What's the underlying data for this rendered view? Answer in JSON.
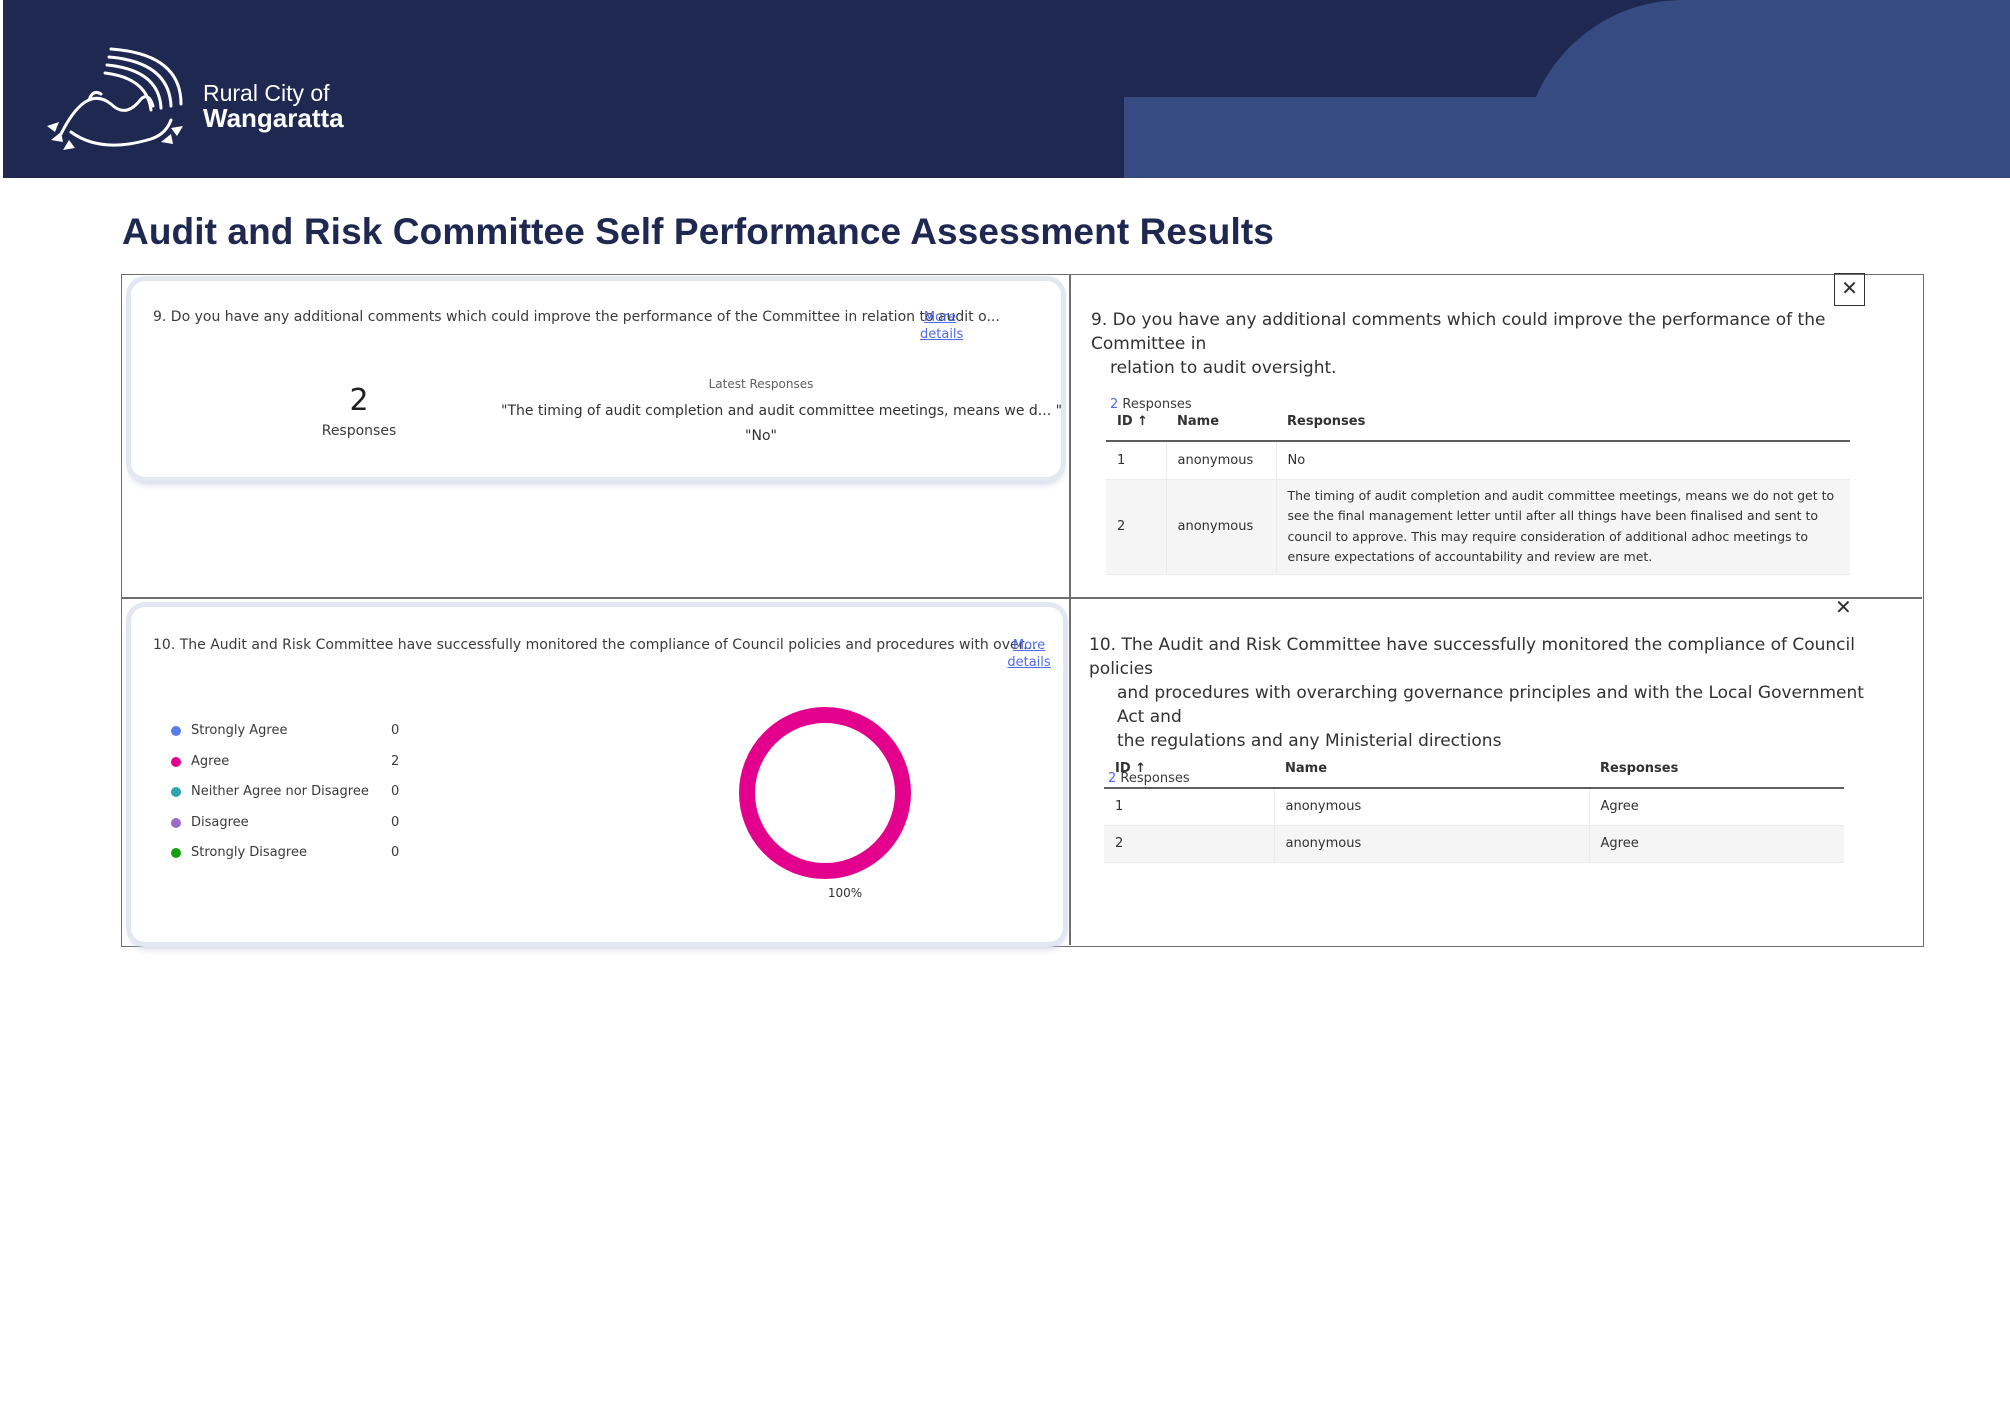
{
  "header": {
    "org_line1": "Rural City of",
    "org_line2": "Wangaratta"
  },
  "page_title": "Audit and Risk Committee Self Performance Assessment Results",
  "q9_card": {
    "question": "9. Do you have any additional comments which could improve the performance of the Committee in relation to audit o...",
    "more_details_1": "More",
    "more_details_2": "details",
    "response_count": "2",
    "response_count_label": "Responses",
    "latest_heading": "Latest Responses",
    "latest_responses": [
      "\"The timing of audit completion and audit committee meetings, means we d... \"",
      "\"No\""
    ]
  },
  "q9_detail": {
    "title": "9. Do you have any additional comments which could improve the performance of the Committee in relation to audit oversight.",
    "title_line1": "9. Do you have any additional comments which could improve the performance of the Committee in",
    "title_line2": "relation to audit oversight.",
    "response_count": "2",
    "response_label": "Responses",
    "columns": [
      "ID ↑",
      "Name",
      "Responses"
    ],
    "rows": [
      {
        "id": "1",
        "name": "anonymous",
        "response": "No"
      },
      {
        "id": "2",
        "name": "anonymous",
        "response": "The timing of audit completion and audit committee meetings, means we do not get to see the final management letter until after all things have been finalised and sent to council to approve. This may require consideration of additional adhoc meetings to ensure expectations of accountability and review are met."
      }
    ]
  },
  "q10_card": {
    "question": "10. The Audit and Risk Committee have successfully monitored the compliance of Council policies and procedures with over...",
    "more_details_1": "More",
    "more_details_2": "details",
    "legend": [
      {
        "label": "Strongly Agree",
        "value": "0",
        "color": "#5b7be8"
      },
      {
        "label": "Agree",
        "value": "2",
        "color": "#e3008c"
      },
      {
        "label": "Neither Agree nor Disagree",
        "value": "0",
        "color": "#2ba5b0"
      },
      {
        "label": "Disagree",
        "value": "0",
        "color": "#9b6bc7"
      },
      {
        "label": "Strongly Disagree",
        "value": "0",
        "color": "#13a10e"
      }
    ],
    "donut_label": "100%"
  },
  "q10_detail": {
    "title_line1": "10. The Audit and Risk Committee have successfully monitored the compliance of Council policies",
    "title_line2": "and procedures with overarching governance principles and with the Local Government Act and",
    "title_line3": "the regulations and any Ministerial directions",
    "response_count": "2",
    "response_label": "Responses",
    "columns": [
      "ID ↑",
      "Name",
      "Responses"
    ],
    "rows": [
      {
        "id": "1",
        "name": "anonymous",
        "response": "Agree"
      },
      {
        "id": "2",
        "name": "anonymous",
        "response": "Agree"
      }
    ]
  },
  "chart_data": {
    "type": "pie",
    "categories": [
      "Strongly Agree",
      "Agree",
      "Neither Agree nor Disagree",
      "Disagree",
      "Strongly Disagree"
    ],
    "values": [
      0,
      2,
      0,
      0,
      0
    ],
    "labels": [
      "100%"
    ]
  }
}
